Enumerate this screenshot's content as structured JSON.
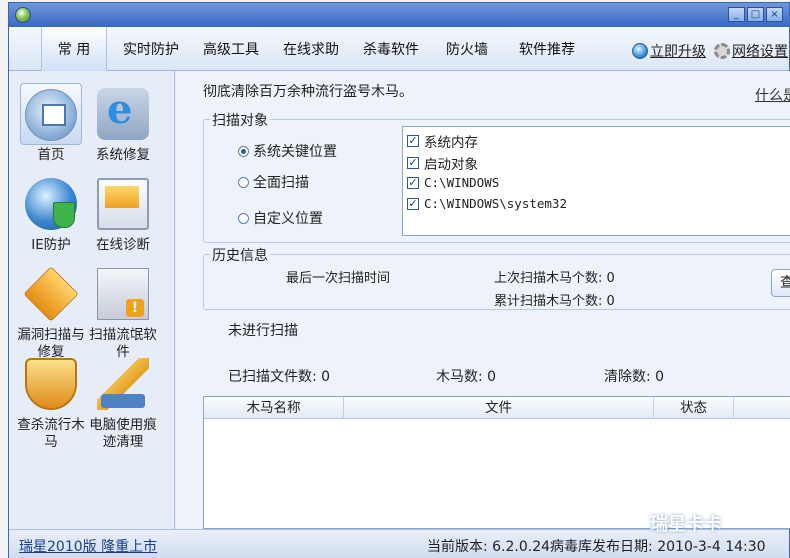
{
  "menu": {
    "items": [
      "常 用",
      "实时防护",
      "高级工具",
      "在线求助",
      "杀毒软件",
      "防火墙",
      "软件推荐"
    ],
    "upgrade": "立即升级",
    "settings": "网络设置"
  },
  "sidebar": {
    "items": [
      "首页",
      "系统修复",
      "IE防护",
      "在线诊断",
      "漏洞扫描与修复",
      "扫描流氓软件",
      "查杀流行木马",
      "电脑使用痕迹清理"
    ]
  },
  "main": {
    "slogan": "彻底清除百万余种流行盗号木马。",
    "whatis": "什么是",
    "scan_target": {
      "title": "扫描对象",
      "options": [
        "系统关键位置",
        "全面扫描",
        "自定义位置"
      ],
      "checks": [
        "系统内存",
        "启动对象",
        "C:\\WINDOWS",
        "C:\\WINDOWS\\system32"
      ]
    },
    "history": {
      "title": "历史信息",
      "last_time_label": "最后一次扫描时间",
      "last_count": "上次扫描木马个数: 0",
      "total_count": "累计扫描木马个数: 0",
      "button": "查"
    },
    "status": "未进行扫描",
    "scanned_files": "已扫描文件数:  0",
    "trojans": "木马数:  0",
    "cleared": "清除数:  0",
    "table": {
      "columns": [
        "木马名称",
        "文件",
        "状态"
      ]
    }
  },
  "statusbar": {
    "left": "瑞星2010版 隆重上市",
    "right": "当前版本: 6.2.0.24病毒库发布日期: 2010-3-4 14:30"
  },
  "watermark": "瑞星卡卡"
}
